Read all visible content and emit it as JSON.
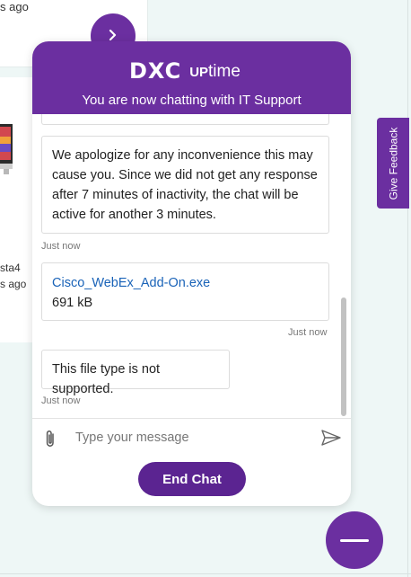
{
  "background": {
    "card_top_text": "s ago",
    "card_mid_text1": "sta4",
    "card_mid_text2": "s ago"
  },
  "feedback_tab": {
    "label": "Give Feedback"
  },
  "chat": {
    "brand": {
      "logo_text": "DXC",
      "product_up": "UP",
      "product_time": "time"
    },
    "header_subtitle": "You are now chatting with IT Support",
    "messages": [
      {
        "text": "We apologize for any inconvenience this may cause you. Since we did not get any response after 7 minutes of inactivity, the chat will be active for another 3 minutes.",
        "time": "Just now"
      },
      {
        "file_name": "Cisco_WebEx_Add-On.exe",
        "file_size": "691 kB",
        "time": "Just now"
      },
      {
        "text": "This file type is not supported.",
        "time": "Just now"
      }
    ],
    "composer": {
      "placeholder": "Type your message"
    },
    "end_chat_label": "End Chat"
  },
  "colors": {
    "brand_purple": "#6b2fa0",
    "button_purple": "#5b2491",
    "link_blue": "#1a63b8",
    "page_background": "#eef7f6"
  },
  "icons": [
    "chevron-right-icon",
    "paperclip-icon",
    "send-icon",
    "minimize-icon"
  ]
}
